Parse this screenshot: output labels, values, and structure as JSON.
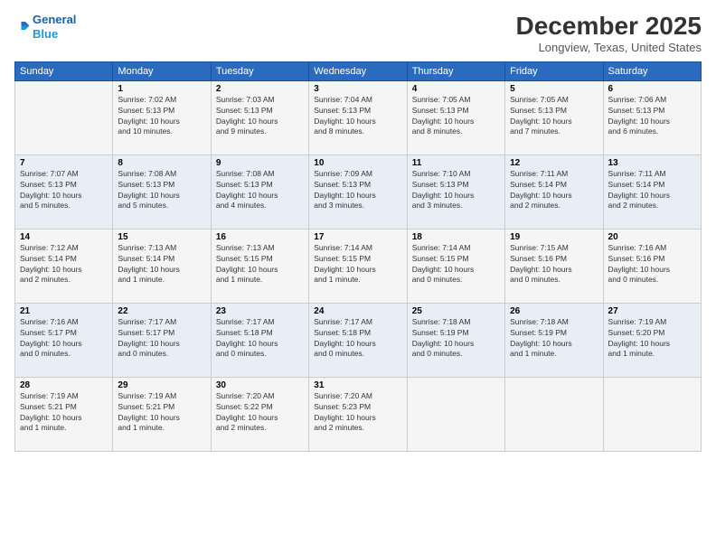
{
  "header": {
    "logo_line1": "General",
    "logo_line2": "Blue",
    "month_title": "December 2025",
    "location": "Longview, Texas, United States"
  },
  "days_of_week": [
    "Sunday",
    "Monday",
    "Tuesday",
    "Wednesday",
    "Thursday",
    "Friday",
    "Saturday"
  ],
  "weeks": [
    [
      {
        "day": "",
        "info": ""
      },
      {
        "day": "1",
        "info": "Sunrise: 7:02 AM\nSunset: 5:13 PM\nDaylight: 10 hours\nand 10 minutes."
      },
      {
        "day": "2",
        "info": "Sunrise: 7:03 AM\nSunset: 5:13 PM\nDaylight: 10 hours\nand 9 minutes."
      },
      {
        "day": "3",
        "info": "Sunrise: 7:04 AM\nSunset: 5:13 PM\nDaylight: 10 hours\nand 8 minutes."
      },
      {
        "day": "4",
        "info": "Sunrise: 7:05 AM\nSunset: 5:13 PM\nDaylight: 10 hours\nand 8 minutes."
      },
      {
        "day": "5",
        "info": "Sunrise: 7:05 AM\nSunset: 5:13 PM\nDaylight: 10 hours\nand 7 minutes."
      },
      {
        "day": "6",
        "info": "Sunrise: 7:06 AM\nSunset: 5:13 PM\nDaylight: 10 hours\nand 6 minutes."
      }
    ],
    [
      {
        "day": "7",
        "info": "Sunrise: 7:07 AM\nSunset: 5:13 PM\nDaylight: 10 hours\nand 5 minutes."
      },
      {
        "day": "8",
        "info": "Sunrise: 7:08 AM\nSunset: 5:13 PM\nDaylight: 10 hours\nand 5 minutes."
      },
      {
        "day": "9",
        "info": "Sunrise: 7:08 AM\nSunset: 5:13 PM\nDaylight: 10 hours\nand 4 minutes."
      },
      {
        "day": "10",
        "info": "Sunrise: 7:09 AM\nSunset: 5:13 PM\nDaylight: 10 hours\nand 3 minutes."
      },
      {
        "day": "11",
        "info": "Sunrise: 7:10 AM\nSunset: 5:13 PM\nDaylight: 10 hours\nand 3 minutes."
      },
      {
        "day": "12",
        "info": "Sunrise: 7:11 AM\nSunset: 5:14 PM\nDaylight: 10 hours\nand 2 minutes."
      },
      {
        "day": "13",
        "info": "Sunrise: 7:11 AM\nSunset: 5:14 PM\nDaylight: 10 hours\nand 2 minutes."
      }
    ],
    [
      {
        "day": "14",
        "info": "Sunrise: 7:12 AM\nSunset: 5:14 PM\nDaylight: 10 hours\nand 2 minutes."
      },
      {
        "day": "15",
        "info": "Sunrise: 7:13 AM\nSunset: 5:14 PM\nDaylight: 10 hours\nand 1 minute."
      },
      {
        "day": "16",
        "info": "Sunrise: 7:13 AM\nSunset: 5:15 PM\nDaylight: 10 hours\nand 1 minute."
      },
      {
        "day": "17",
        "info": "Sunrise: 7:14 AM\nSunset: 5:15 PM\nDaylight: 10 hours\nand 1 minute."
      },
      {
        "day": "18",
        "info": "Sunrise: 7:14 AM\nSunset: 5:15 PM\nDaylight: 10 hours\nand 0 minutes."
      },
      {
        "day": "19",
        "info": "Sunrise: 7:15 AM\nSunset: 5:16 PM\nDaylight: 10 hours\nand 0 minutes."
      },
      {
        "day": "20",
        "info": "Sunrise: 7:16 AM\nSunset: 5:16 PM\nDaylight: 10 hours\nand 0 minutes."
      }
    ],
    [
      {
        "day": "21",
        "info": "Sunrise: 7:16 AM\nSunset: 5:17 PM\nDaylight: 10 hours\nand 0 minutes."
      },
      {
        "day": "22",
        "info": "Sunrise: 7:17 AM\nSunset: 5:17 PM\nDaylight: 10 hours\nand 0 minutes."
      },
      {
        "day": "23",
        "info": "Sunrise: 7:17 AM\nSunset: 5:18 PM\nDaylight: 10 hours\nand 0 minutes."
      },
      {
        "day": "24",
        "info": "Sunrise: 7:17 AM\nSunset: 5:18 PM\nDaylight: 10 hours\nand 0 minutes."
      },
      {
        "day": "25",
        "info": "Sunrise: 7:18 AM\nSunset: 5:19 PM\nDaylight: 10 hours\nand 0 minutes."
      },
      {
        "day": "26",
        "info": "Sunrise: 7:18 AM\nSunset: 5:19 PM\nDaylight: 10 hours\nand 1 minute."
      },
      {
        "day": "27",
        "info": "Sunrise: 7:19 AM\nSunset: 5:20 PM\nDaylight: 10 hours\nand 1 minute."
      }
    ],
    [
      {
        "day": "28",
        "info": "Sunrise: 7:19 AM\nSunset: 5:21 PM\nDaylight: 10 hours\nand 1 minute."
      },
      {
        "day": "29",
        "info": "Sunrise: 7:19 AM\nSunset: 5:21 PM\nDaylight: 10 hours\nand 1 minute."
      },
      {
        "day": "30",
        "info": "Sunrise: 7:20 AM\nSunset: 5:22 PM\nDaylight: 10 hours\nand 2 minutes."
      },
      {
        "day": "31",
        "info": "Sunrise: 7:20 AM\nSunset: 5:23 PM\nDaylight: 10 hours\nand 2 minutes."
      },
      {
        "day": "",
        "info": ""
      },
      {
        "day": "",
        "info": ""
      },
      {
        "day": "",
        "info": ""
      }
    ]
  ]
}
